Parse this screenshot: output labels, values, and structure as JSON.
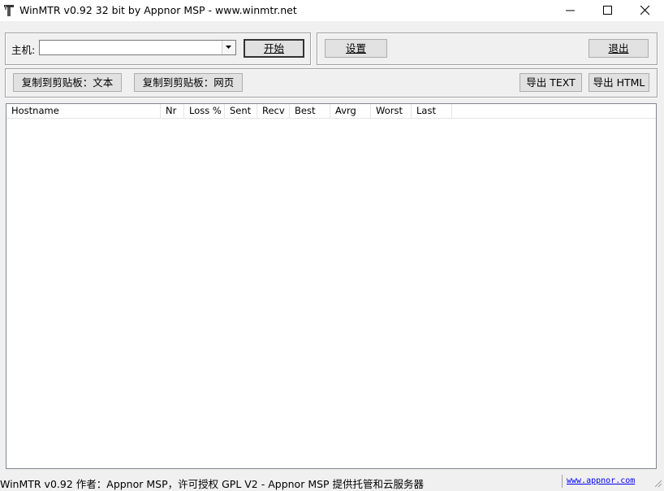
{
  "window": {
    "title": "WinMTR v0.92 32 bit by Appnor MSP - www.winmtr.net"
  },
  "host": {
    "label": "主机:",
    "value": ""
  },
  "buttons": {
    "start": "开始",
    "settings": "设置",
    "exit": "退出",
    "copy_text": "复制到剪贴板：文本",
    "copy_html": "复制到剪贴板：网页",
    "export_text": "导出 TEXT",
    "export_html": "导出 HTML"
  },
  "table": {
    "columns": [
      "Hostname",
      "Nr",
      "Loss %",
      "Sent",
      "Recv",
      "Best",
      "Avrg",
      "Worst",
      "Last"
    ],
    "rows": []
  },
  "status": {
    "text": "WinMTR v0.92 作者：Appnor MSP，许可授权 GPL V2 - Appnor MSP 提供托管和云服务器",
    "link": "www.appnor.com"
  }
}
